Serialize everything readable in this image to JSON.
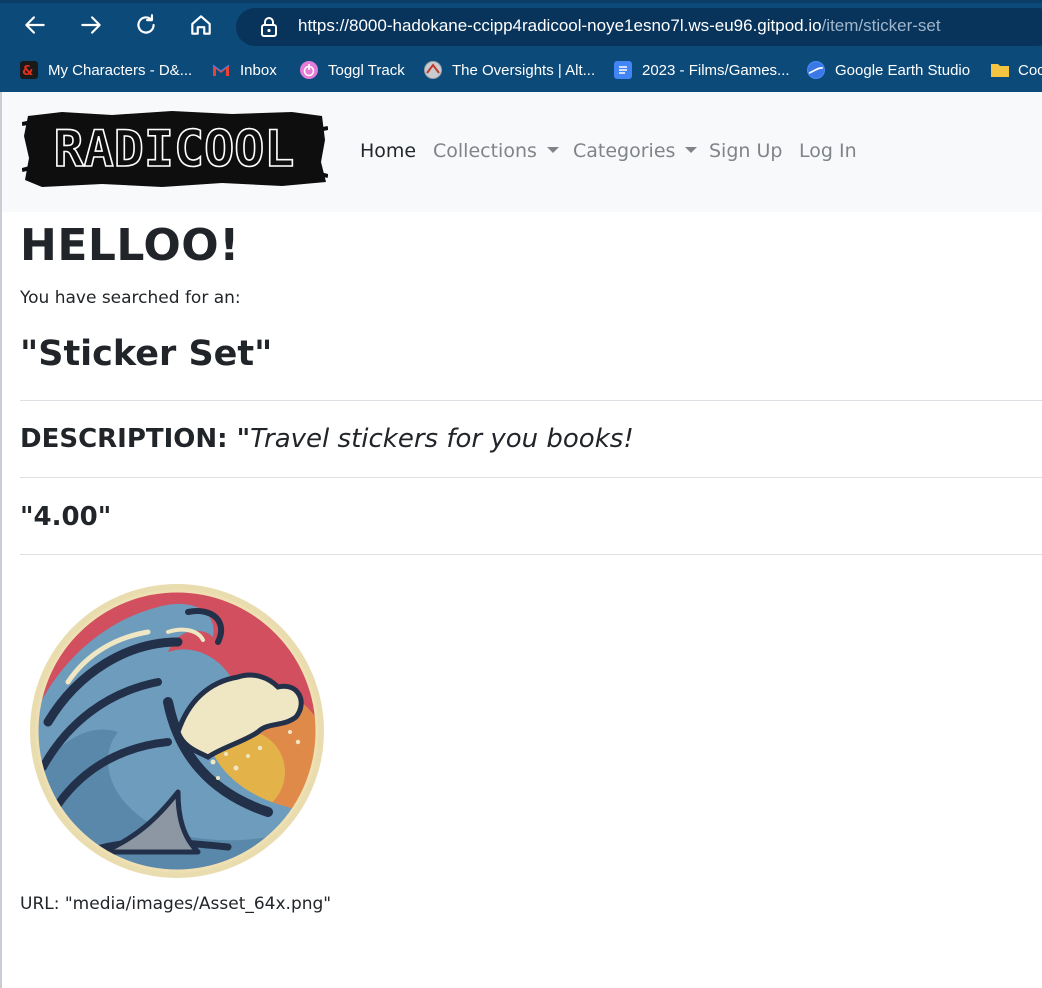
{
  "browser": {
    "url_main": "https://8000-hadokane-ccipp4radicool-noye1esno7l.ws-eu96.gitpod.io",
    "url_path": "/item/sticker-set",
    "bookmarks": [
      {
        "label": "My Characters - D&...",
        "icon": "dnd-icon",
        "color": "#e0301e"
      },
      {
        "label": "Inbox",
        "icon": "gmail-icon",
        "color": "#ea4335"
      },
      {
        "label": "Toggl Track",
        "icon": "toggl-icon",
        "color": "#e57cd8"
      },
      {
        "label": "The Oversights | Alt...",
        "icon": "oversights-icon",
        "color": "#9aa0a6"
      },
      {
        "label": "2023 - Films/Games...",
        "icon": "docs-icon",
        "color": "#4285f4"
      },
      {
        "label": "Google Earth Studio",
        "icon": "earth-studio-icon",
        "color": "#4a8af4"
      },
      {
        "label": "Coc",
        "icon": "folder-icon",
        "color": "#f5c542"
      }
    ]
  },
  "navbar": {
    "logo_text": "RADICOOL",
    "items": [
      {
        "label": "Home",
        "active": true,
        "dropdown": false
      },
      {
        "label": "Collections",
        "active": false,
        "dropdown": true
      },
      {
        "label": "Categories",
        "active": false,
        "dropdown": true
      },
      {
        "label": "Sign Up",
        "active": false,
        "dropdown": false
      },
      {
        "label": "Log In",
        "active": false,
        "dropdown": false
      }
    ]
  },
  "main": {
    "greeting": "HELLOO!",
    "searched_text": "You have searched for an:",
    "item_name": "\"Sticker Set\"",
    "description_label": "DESCRIPTION: \"",
    "description_text": "Travel stickers for you books!",
    "price": "\"4.00\"",
    "image_url_text": "URL: \"media/images/Asset_64x.png\""
  },
  "colors": {
    "chrome_bg": "#0c4a7a",
    "navbar_bg": "#f8f9fa",
    "nav_link": "#808489",
    "nav_active": "#23272b"
  }
}
